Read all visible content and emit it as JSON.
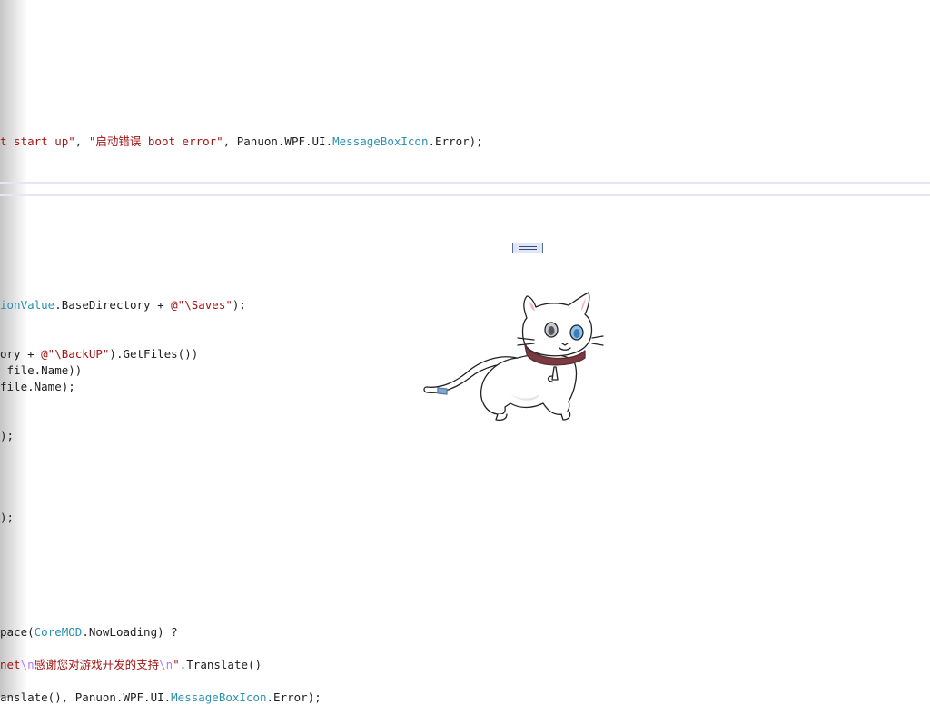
{
  "editor": {
    "lines": [
      {
        "parts": [
          {
            "t": "t start up\"",
            "c": "str"
          },
          {
            "t": ", ",
            "c": "plain"
          },
          {
            "t": "\"启动错误 boot error\"",
            "c": "str"
          },
          {
            "t": ", Panuon.WPF.UI.",
            "c": "plain"
          },
          {
            "t": "MessageBoxIcon",
            "c": "type"
          },
          {
            "t": ".Error);",
            "c": "plain"
          }
        ]
      },
      {
        "parts": [
          {
            "t": "ionValue",
            "c": "type"
          },
          {
            "t": ".BaseDirectory + ",
            "c": "plain"
          },
          {
            "t": "@\"\\Saves\"",
            "c": "str"
          },
          {
            "t": ");",
            "c": "plain"
          }
        ]
      },
      {
        "parts": [
          {
            "t": "ory + ",
            "c": "plain"
          },
          {
            "t": "@\"\\BackUP\"",
            "c": "str"
          },
          {
            "t": ").GetFiles())",
            "c": "plain"
          }
        ]
      },
      {
        "parts": [
          {
            "t": " file.Name))",
            "c": "plain"
          }
        ]
      },
      {
        "parts": [
          {
            "t": "file.Name);",
            "c": "plain"
          }
        ]
      },
      {
        "parts": [
          {
            "t": ");",
            "c": "plain"
          }
        ]
      },
      {
        "parts": [
          {
            "t": ");",
            "c": "plain"
          }
        ]
      },
      {
        "parts": [
          {
            "t": "pace(",
            "c": "plain"
          },
          {
            "t": "CoreMOD",
            "c": "type"
          },
          {
            "t": ".NowLoading) ?",
            "c": "plain"
          }
        ]
      },
      {
        "parts": [
          {
            "t": "net",
            "c": "str"
          },
          {
            "t": "\\n",
            "c": "esc"
          },
          {
            "t": "感谢您对游戏开发的支持",
            "c": "str"
          },
          {
            "t": "\\n",
            "c": "esc"
          },
          {
            "t": "\"",
            "c": "str"
          },
          {
            "t": ".Translate()",
            "c": "plain"
          }
        ]
      },
      {
        "parts": [
          {
            "t": "anslate(), Panuon.WPF.UI.",
            "c": "plain"
          },
          {
            "t": "MessageBoxIcon",
            "c": "type"
          },
          {
            "t": ".Error);",
            "c": "plain"
          }
        ]
      }
    ]
  },
  "pet": {
    "icon": "white-cat-desktop-pet"
  },
  "pet_control": {
    "icon": "minimize-bar-icon"
  }
}
